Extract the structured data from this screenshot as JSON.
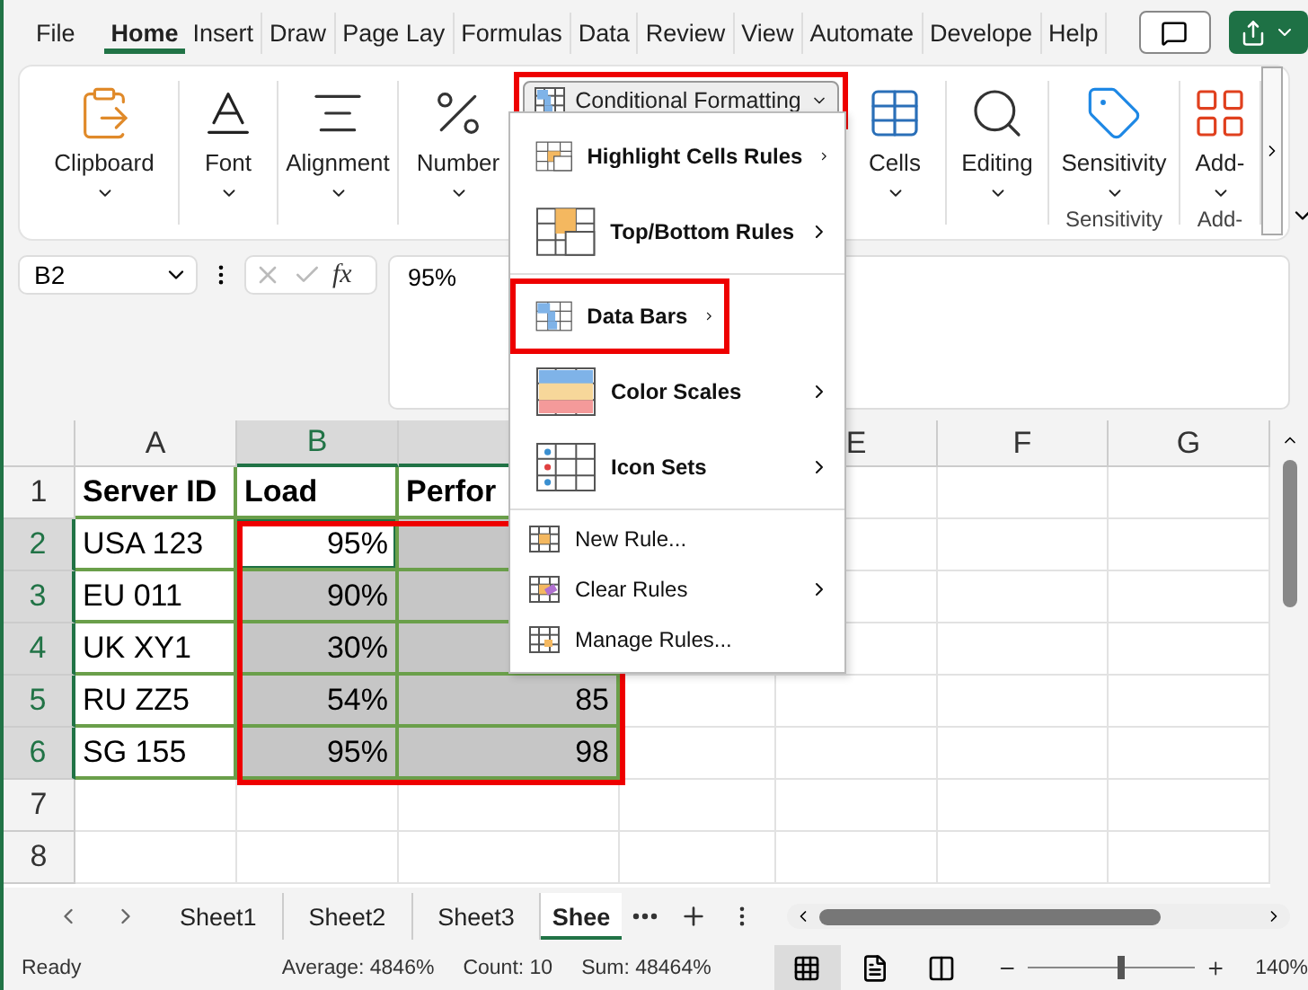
{
  "menu_tabs": [
    {
      "label": "File",
      "selected": false
    },
    {
      "label": "Home",
      "selected": true
    },
    {
      "label": "Insert",
      "selected": false
    },
    {
      "label": "Draw",
      "selected": false
    },
    {
      "label": "Page Lay",
      "selected": false
    },
    {
      "label": "Formulas",
      "selected": false
    },
    {
      "label": "Data",
      "selected": false
    },
    {
      "label": "Review",
      "selected": false
    },
    {
      "label": "View",
      "selected": false
    },
    {
      "label": "Automate",
      "selected": false
    },
    {
      "label": "Develope",
      "selected": false
    },
    {
      "label": "Help",
      "selected": false
    }
  ],
  "ribbon": {
    "items": [
      {
        "kind": "big",
        "label": "Clipboard"
      },
      {
        "kind": "big",
        "label": "Font"
      },
      {
        "kind": "big",
        "label": "Alignment"
      },
      {
        "kind": "big",
        "label": "Number"
      },
      {
        "kind": "menu",
        "label": "Conditional Formatting",
        "annotated": true
      },
      {
        "kind": "big",
        "label": "Cells"
      },
      {
        "kind": "big",
        "label": "Editing"
      },
      {
        "kind": "big",
        "label": "Sensitivity",
        "caption": "Sensitivity"
      },
      {
        "kind": "big",
        "label": "Add-",
        "caption": "Add-"
      }
    ]
  },
  "formula_bar": {
    "name_box": "B2",
    "fx": "fx",
    "formula": "95%"
  },
  "columns": [
    {
      "label": "A",
      "selected": false
    },
    {
      "label": "B",
      "selected": true
    },
    {
      "selected": true
    },
    {},
    {
      "label": "E",
      "selected": false
    },
    {
      "label": "F",
      "selected": false
    },
    {
      "label": "G",
      "selected": false
    }
  ],
  "rows": [
    {
      "header": "1",
      "selected": false,
      "cells": [
        {
          "kind": "head",
          "text": "Server ID",
          "selected": false
        },
        {
          "kind": "head",
          "text": "Load",
          "selected": false
        },
        {
          "kind": "head",
          "text": "Perfor",
          "selected": false
        },
        {
          "kind": "empty"
        },
        {
          "kind": "empty",
          "selected": false
        },
        {
          "kind": "empty",
          "selected": false
        },
        {
          "kind": "empty",
          "selected": false
        }
      ]
    },
    {
      "header": "2",
      "selected": true,
      "cells": [
        {
          "kind": "text",
          "text": "USA 123",
          "selected": false
        },
        {
          "kind": "number",
          "text": "95%",
          "active": true
        },
        {
          "kind": "number",
          "selected": true
        },
        {
          "kind": "empty"
        },
        {
          "kind": "empty",
          "selected": false
        },
        {
          "kind": "empty",
          "selected": false
        },
        {
          "kind": "empty",
          "selected": false
        }
      ]
    },
    {
      "header": "3",
      "selected": true,
      "cells": [
        {
          "kind": "text",
          "text": "EU 011",
          "selected": false
        },
        {
          "kind": "number",
          "text": "90%",
          "selected": true
        },
        {
          "kind": "number",
          "selected": true
        },
        {
          "kind": "empty"
        },
        {
          "kind": "empty",
          "selected": false
        },
        {
          "kind": "empty",
          "selected": false
        },
        {
          "kind": "empty",
          "selected": false
        }
      ]
    },
    {
      "header": "4",
      "selected": true,
      "cells": [
        {
          "kind": "text",
          "text": "UK XY1",
          "selected": false
        },
        {
          "kind": "number",
          "text": "30%",
          "selected": true
        },
        {
          "kind": "number",
          "selected": true
        },
        {
          "kind": "empty"
        },
        {
          "kind": "empty",
          "selected": false
        },
        {
          "kind": "empty",
          "selected": false
        },
        {
          "kind": "empty",
          "selected": false
        }
      ]
    },
    {
      "header": "5",
      "selected": true,
      "cells": [
        {
          "kind": "text",
          "text": "RU ZZ5",
          "selected": false
        },
        {
          "kind": "number",
          "text": "54%",
          "selected": true
        },
        {
          "kind": "number",
          "text": "85",
          "selected": true
        },
        {
          "kind": "empty",
          "selected": false
        },
        {
          "kind": "empty",
          "selected": false
        },
        {
          "kind": "empty",
          "selected": false
        },
        {
          "kind": "empty",
          "selected": false
        }
      ]
    },
    {
      "header": "6",
      "selected": true,
      "cells": [
        {
          "kind": "text",
          "text": "SG 155",
          "selected": false
        },
        {
          "kind": "number",
          "text": "95%",
          "selected": true
        },
        {
          "kind": "number",
          "text": "98",
          "selected": true
        },
        {
          "kind": "empty",
          "selected": false
        },
        {
          "kind": "empty",
          "selected": false
        },
        {
          "kind": "empty",
          "selected": false
        },
        {
          "kind": "empty",
          "selected": false
        }
      ]
    },
    {
      "header": "7",
      "selected": false,
      "cells": [
        {
          "kind": "empty",
          "selected": false
        },
        {
          "kind": "empty",
          "selected": false
        },
        {
          "kind": "empty",
          "selected": false
        },
        {
          "kind": "empty",
          "selected": false
        },
        {
          "kind": "empty",
          "selected": false
        },
        {
          "kind": "empty",
          "selected": false
        },
        {
          "kind": "empty",
          "selected": false
        }
      ]
    },
    {
      "header": "8",
      "selected": false,
      "cells": [
        {
          "kind": "empty",
          "selected": false
        },
        {
          "kind": "empty",
          "selected": false
        },
        {
          "kind": "empty",
          "selected": false
        },
        {
          "kind": "empty",
          "selected": false
        },
        {
          "kind": "empty",
          "selected": false
        },
        {
          "kind": "empty",
          "selected": false
        },
        {
          "kind": "empty",
          "selected": false
        }
      ]
    }
  ],
  "selection_annotated": true,
  "cf_menu": [
    {
      "kind": "large",
      "label": "Highlight Cells Rules",
      "submenu": true,
      "annotated": false
    },
    {
      "kind": "large",
      "label": "Top/Bottom Rules",
      "submenu": true,
      "annotated": false
    },
    {
      "kind": "separator"
    },
    {
      "kind": "large",
      "label": "Data Bars",
      "submenu": true,
      "annotated": true
    },
    {
      "kind": "large",
      "label": "Color Scales",
      "submenu": true,
      "annotated": false
    },
    {
      "kind": "large",
      "label": "Icon Sets",
      "submenu": true,
      "annotated": false
    },
    {
      "kind": "separator"
    },
    {
      "kind": "small",
      "label": "New Rule...",
      "submenu": false,
      "annotated": false
    },
    {
      "kind": "small",
      "label": "Clear Rules",
      "submenu": true,
      "annotated": false
    },
    {
      "kind": "small",
      "label": "Manage Rules...",
      "submenu": false,
      "annotated": false
    }
  ],
  "sheet_tabs": [
    {
      "label": "Sheet1",
      "selected": false
    },
    {
      "label": "Sheet2",
      "selected": false
    },
    {
      "label": "Sheet3",
      "selected": false
    },
    {
      "label": "Shee",
      "selected": true
    }
  ],
  "status_bar": {
    "status": "Ready",
    "stats": [
      "Average: 4846%",
      "Count: 10",
      "Sum: 48464%"
    ],
    "views": [
      {
        "selected": true
      },
      {
        "selected": false
      },
      {
        "selected": false
      }
    ],
    "zoom": {
      "level": 0.56,
      "reading": "140%"
    }
  }
}
